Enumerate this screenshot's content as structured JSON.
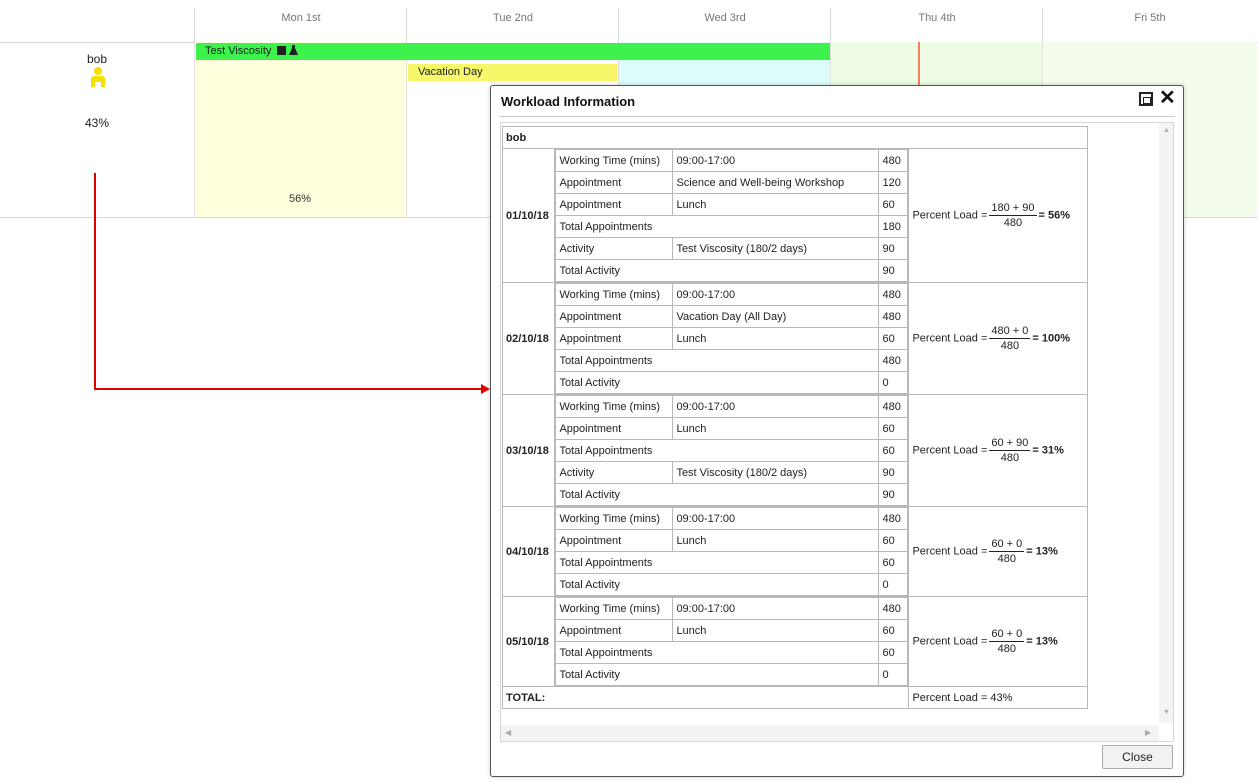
{
  "scheduler": {
    "days": [
      "Mon 1st",
      "Tue 2nd",
      "Wed 3rd",
      "Thu 4th",
      "Fri 5th"
    ],
    "resource": {
      "name": "bob",
      "percent": "43%"
    },
    "events": {
      "green": "Test Viscosity",
      "yellow": "Vacation Day"
    },
    "mon_percent": "56%",
    "colors": {
      "green_event": "#3ef24e",
      "yellow_event": "#f7f76a",
      "mon_bg": "#ffffdd",
      "wed_bg": "#ddfcfc",
      "thu_bg": "#eefbe5",
      "fri_bg": "#f4fceb",
      "arrow": "#e00000"
    }
  },
  "dialog": {
    "title": "Workload Information",
    "resource": "bob",
    "close_label": "Close",
    "total_label": "TOTAL:",
    "total_load": "Percent Load = 43%",
    "days": [
      {
        "date": "01/10/18",
        "rows": [
          [
            "Working Time (mins)",
            "09:00-17:00",
            "480"
          ],
          [
            "Appointment",
            "Science and Well-being Workshop",
            "120"
          ],
          [
            "Appointment",
            "Lunch",
            "60"
          ],
          [
            "Total Appointments",
            "",
            "180"
          ],
          [
            "Activity",
            "Test Viscosity (180/2 days)",
            "90"
          ],
          [
            "Total Activity",
            "",
            "90"
          ]
        ],
        "load_prefix": "Percent Load =",
        "numerator": "180 + 90",
        "denominator": "480",
        "result": "= 56%"
      },
      {
        "date": "02/10/18",
        "rows": [
          [
            "Working Time (mins)",
            "09:00-17:00",
            "480"
          ],
          [
            "Appointment",
            "Vacation Day (All Day)",
            "480"
          ],
          [
            "Appointment",
            "Lunch",
            "60"
          ],
          [
            "Total Appointments",
            "",
            "480"
          ],
          [
            "Total Activity",
            "",
            "0"
          ]
        ],
        "load_prefix": "Percent Load =",
        "numerator": "480 + 0",
        "denominator": "480",
        "result": "= 100%"
      },
      {
        "date": "03/10/18",
        "rows": [
          [
            "Working Time (mins)",
            "09:00-17:00",
            "480"
          ],
          [
            "Appointment",
            "Lunch",
            "60"
          ],
          [
            "Total Appointments",
            "",
            "60"
          ],
          [
            "Activity",
            "Test Viscosity (180/2 days)",
            "90"
          ],
          [
            "Total Activity",
            "",
            "90"
          ]
        ],
        "load_prefix": "Percent Load =",
        "numerator": "60 + 90",
        "denominator": "480",
        "result": "= 31%"
      },
      {
        "date": "04/10/18",
        "rows": [
          [
            "Working Time (mins)",
            "09:00-17:00",
            "480"
          ],
          [
            "Appointment",
            "Lunch",
            "60"
          ],
          [
            "Total Appointments",
            "",
            "60"
          ],
          [
            "Total Activity",
            "",
            "0"
          ]
        ],
        "load_prefix": "Percent Load =",
        "numerator": "60 + 0",
        "denominator": "480",
        "result": "= 13%"
      },
      {
        "date": "05/10/18",
        "rows": [
          [
            "Working Time (mins)",
            "09:00-17:00",
            "480"
          ],
          [
            "Appointment",
            "Lunch",
            "60"
          ],
          [
            "Total Appointments",
            "",
            "60"
          ],
          [
            "Total Activity",
            "",
            "0"
          ]
        ],
        "load_prefix": "Percent Load =",
        "numerator": "60 + 0",
        "denominator": "480",
        "result": "= 13%"
      }
    ]
  }
}
